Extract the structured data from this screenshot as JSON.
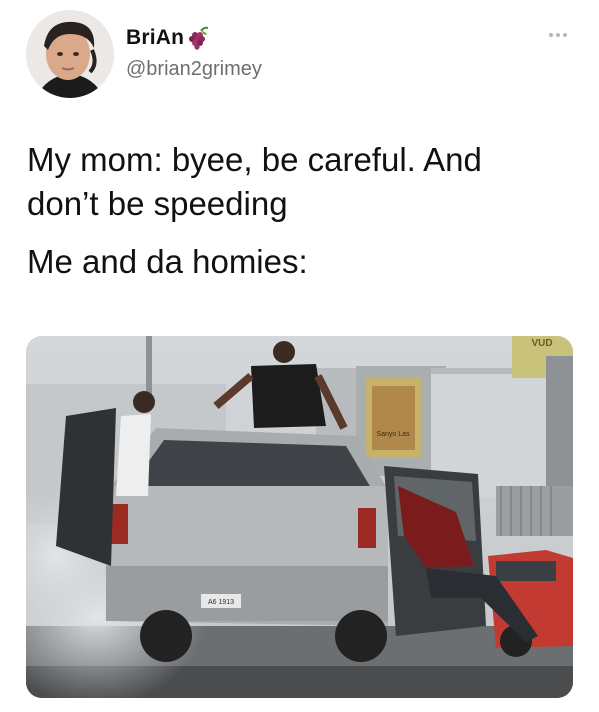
{
  "author": {
    "display_name": "BriAn",
    "handle": "@brian2grimey",
    "emoji_icon": "grapes-icon"
  },
  "tweet": {
    "line1": "My mom: byee, be careful. And",
    "line2": "don’t be speeding",
    "line3": "Me and da homies:"
  },
  "media": {
    "billboard_text": "Sanyo Las",
    "sign_text": "VUD",
    "plate_text": "A6 1913"
  },
  "colors": {
    "handle": "#6b6f73",
    "text": "#111111",
    "more_dots": "#b4b8bc"
  }
}
